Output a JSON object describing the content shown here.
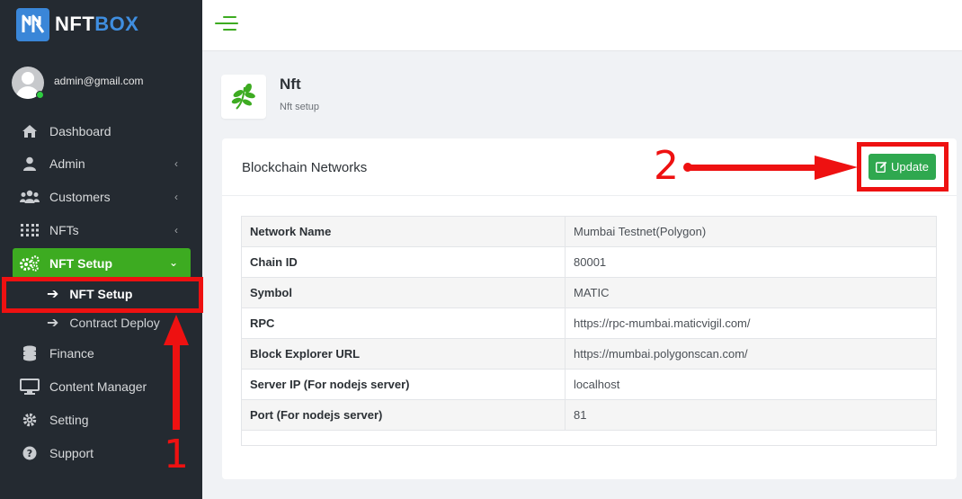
{
  "brand": {
    "name_part1": "NFT",
    "name_part2": "BOX",
    "accent": "#3f8ee0"
  },
  "user": {
    "email": "admin@gmail.com",
    "status": "online"
  },
  "sidebar": {
    "items": [
      {
        "label": "Dashboard",
        "icon": "home-icon"
      },
      {
        "label": "Admin",
        "icon": "user-icon",
        "chevron": "‹"
      },
      {
        "label": "Customers",
        "icon": "users-icon",
        "chevron": "‹"
      },
      {
        "label": "NFTs",
        "icon": "grid-dots-icon",
        "chevron": "‹"
      },
      {
        "label": "NFT Setup",
        "icon": "gears-icon",
        "chevron": "⌄",
        "active": true
      },
      {
        "label": "Finance",
        "icon": "coins-icon"
      },
      {
        "label": "Content Manager",
        "icon": "monitor-icon"
      },
      {
        "label": "Setting",
        "icon": "gear-icon"
      },
      {
        "label": "Support",
        "icon": "question-icon"
      }
    ],
    "subitems": [
      {
        "label": "NFT Setup",
        "current": true
      },
      {
        "label": "Contract Deploy"
      }
    ]
  },
  "page": {
    "title": "Nft",
    "subtitle": "Nft setup",
    "icon": "leaf-icon"
  },
  "card": {
    "title": "Blockchain Networks",
    "update_label": "Update",
    "rows": [
      {
        "key": "Network Name",
        "value": "Mumbai Testnet(Polygon)"
      },
      {
        "key": "Chain ID",
        "value": "80001"
      },
      {
        "key": "Symbol",
        "value": "MATIC"
      },
      {
        "key": "RPC",
        "value": "https://rpc-mumbai.maticvigil.com/"
      },
      {
        "key": "Block Explorer URL",
        "value": "https://mumbai.polygonscan.com/"
      },
      {
        "key": "Server IP (For nodejs server)",
        "value": "localhost"
      },
      {
        "key": "Port (For nodejs server)",
        "value": "81"
      }
    ]
  },
  "annotations": {
    "step1": "1",
    "step2": "2",
    "color": "#ee1111"
  },
  "colors": {
    "sidebar_bg": "#242a31",
    "active_green": "#3dab21",
    "button_green": "#2fa84f"
  }
}
